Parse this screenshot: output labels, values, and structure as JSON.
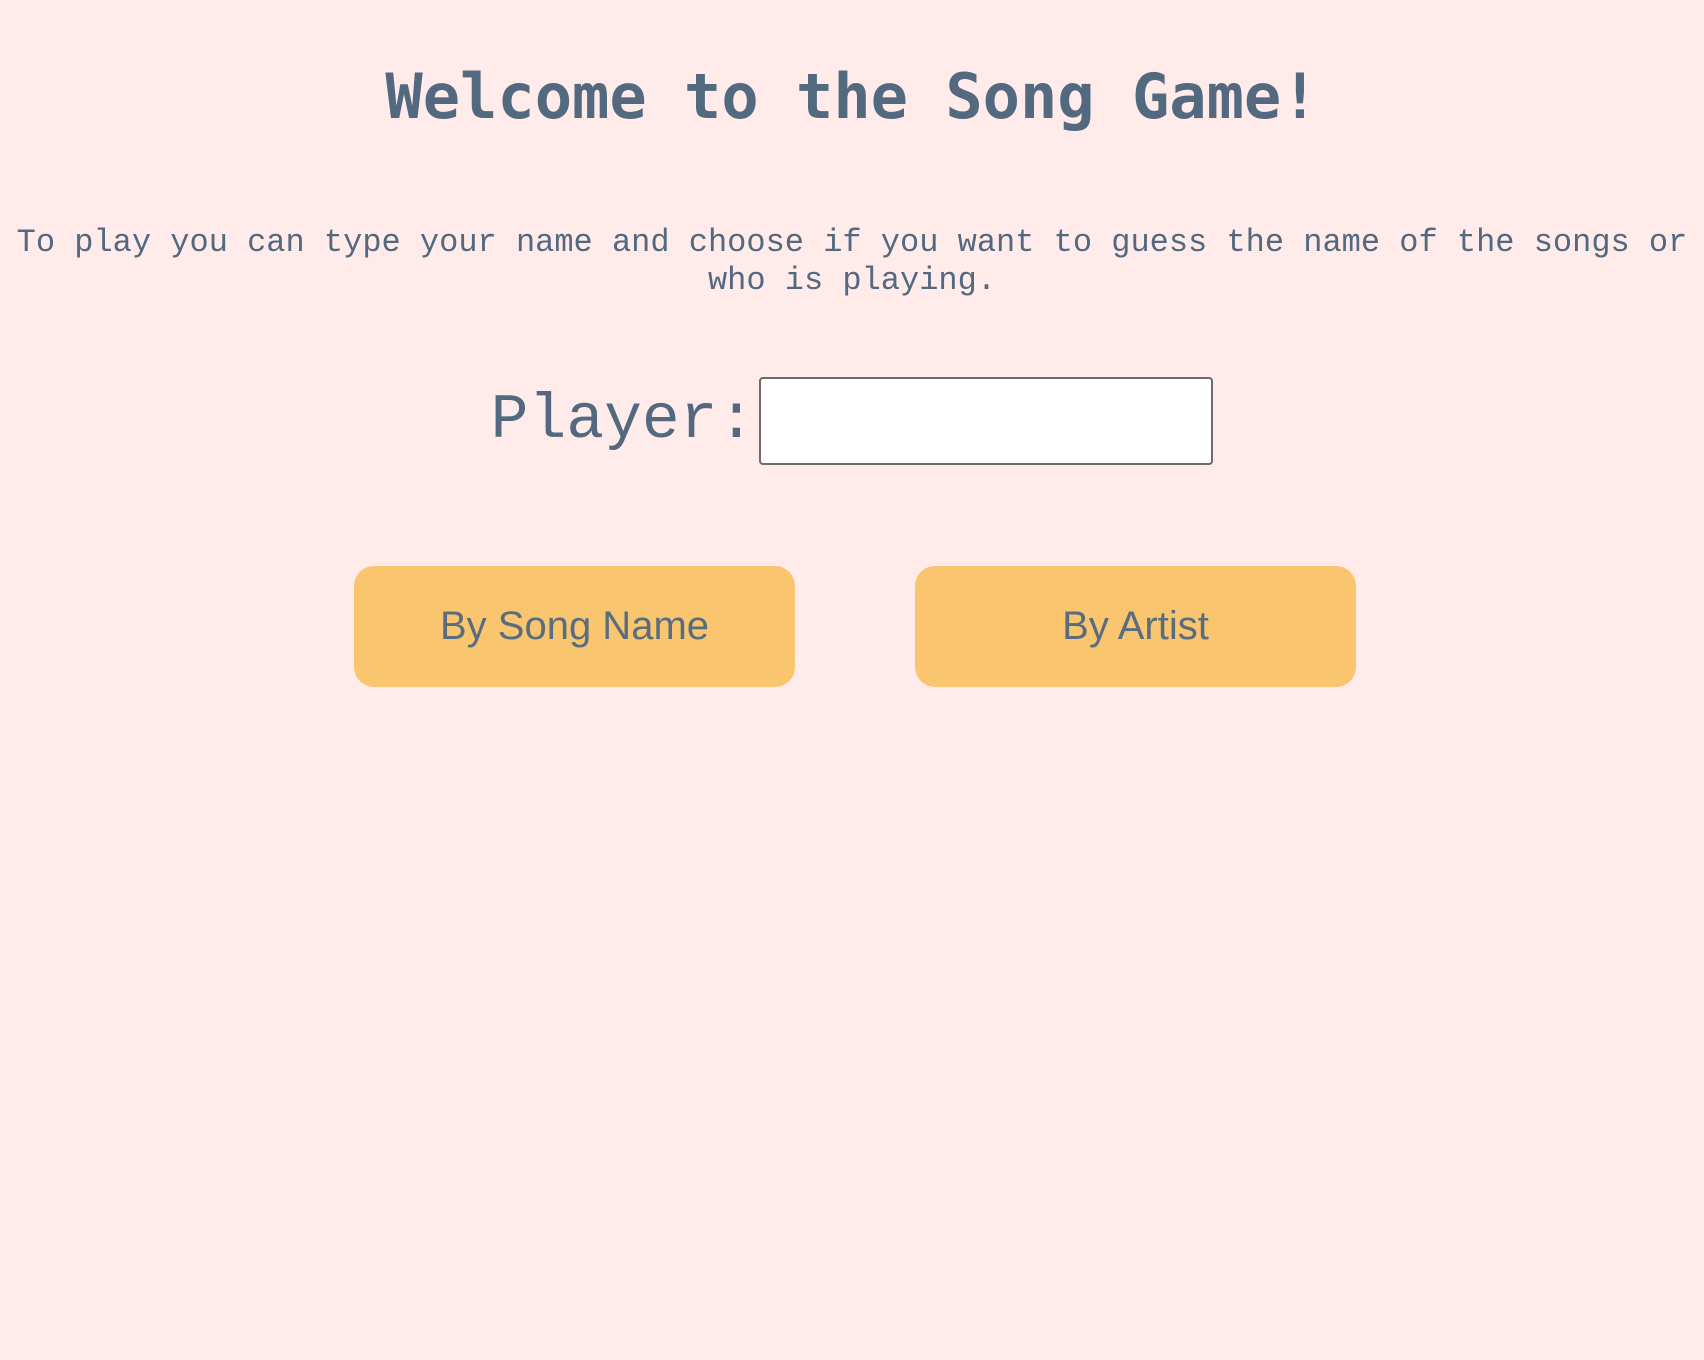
{
  "header": {
    "title": "Welcome to the Song Game!"
  },
  "instructions": {
    "text": "To play you can type your name and choose if you want to guess the name of the songs or who is playing."
  },
  "player": {
    "label": "Player:",
    "value": "",
    "placeholder": ""
  },
  "modes": {
    "song_name_label": "By Song Name",
    "artist_label": "By Artist"
  },
  "colors": {
    "background": "#ffebe9",
    "text": "#52697f",
    "button": "#f9c56f"
  }
}
